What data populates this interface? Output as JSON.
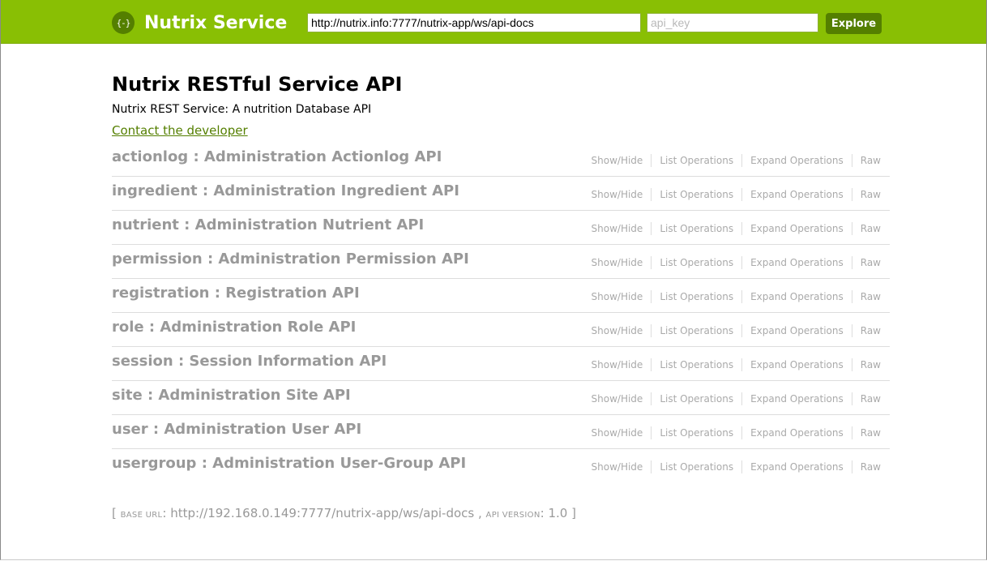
{
  "header": {
    "logo_glyph": "{-}",
    "title": "Nutrix Service",
    "url_value": "http://nutrix.info:7777/nutrix-app/ws/api-docs",
    "api_key_placeholder": "api_key",
    "api_key_value": "",
    "explore_label": "Explore",
    "colors": {
      "bar": "#89bf04",
      "button": "#547f00"
    }
  },
  "info": {
    "title": "Nutrix RESTful Service API",
    "description": "Nutrix REST Service: A nutrition Database API",
    "contact_label": "Contact the developer"
  },
  "resources": [
    {
      "name": "actionlog : Administration Actionlog API"
    },
    {
      "name": "ingredient : Administration Ingredient API"
    },
    {
      "name": "nutrient : Administration Nutrient API"
    },
    {
      "name": "permission : Administration Permission API"
    },
    {
      "name": "registration : Registration API"
    },
    {
      "name": "role : Administration Role API"
    },
    {
      "name": "session : Session Information API"
    },
    {
      "name": "site : Administration Site API"
    },
    {
      "name": "user : Administration User API"
    },
    {
      "name": "usergroup : Administration User-Group API"
    }
  ],
  "operations": {
    "show_hide": "Show/Hide",
    "list": "List Operations",
    "expand": "Expand Operations",
    "raw": "Raw"
  },
  "footer": {
    "open": "[ ",
    "base_url_label": "base url",
    "base_url_sep": ": ",
    "base_url": "http://192.168.0.149:7777/nutrix-app/ws/api-docs",
    "comma": " , ",
    "api_version_label": "api version",
    "version_sep": ": ",
    "api_version": "1.0",
    "close": " ]"
  }
}
